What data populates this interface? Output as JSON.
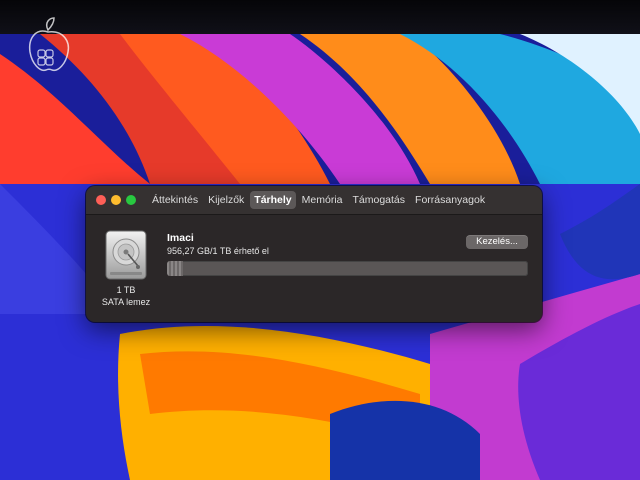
{
  "window": {
    "tabs": [
      {
        "label": "Áttekintés",
        "active": false
      },
      {
        "label": "Kijelzők",
        "active": false
      },
      {
        "label": "Tárhely",
        "active": true
      },
      {
        "label": "Memória",
        "active": false
      },
      {
        "label": "Támogatás",
        "active": false
      },
      {
        "label": "Forrásanyagok",
        "active": false
      }
    ],
    "traffic_lights": {
      "close": "#fe5f57",
      "minimize": "#febc2e",
      "zoom": "#28c840"
    }
  },
  "storage": {
    "disk_icon": "hard-drive-icon",
    "disk_size": "1 TB",
    "disk_type": "SATA lemez",
    "volume_name": "Imaci",
    "available_text": "956,27 GB/1 TB érhető el",
    "manage_button": "Kezelés...",
    "used_fraction": 0.044
  },
  "colors": {
    "window_bg": "#2b2728",
    "active_tab": "#5c5858",
    "wallpaper_accents": [
      "#2c2fd6",
      "#ff5a1f",
      "#c93bd6",
      "#ffb000",
      "#1fa8e0"
    ]
  }
}
